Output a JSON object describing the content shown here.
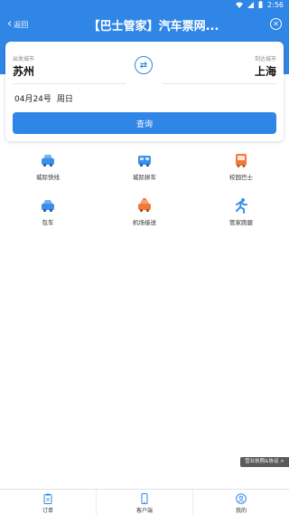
{
  "status": {
    "time": "2:56"
  },
  "header": {
    "back_label": "返回",
    "title": "【巴士管家】汽车票网..."
  },
  "search": {
    "from_label": "出发城市",
    "from_city": "苏州",
    "to_label": "到达城市",
    "to_city": "上海",
    "date": "04月24号",
    "weekday": "周日",
    "button_label": "查询"
  },
  "services": [
    {
      "label": "城际快线",
      "icon": "car-icon",
      "color": "#3b8fe6"
    },
    {
      "label": "城际拼车",
      "icon": "van-icon",
      "color": "#3b8fe6"
    },
    {
      "label": "校园巴士",
      "icon": "bus-icon",
      "color": "#f07a3a"
    },
    {
      "label": "包车",
      "icon": "car-icon",
      "color": "#3b8fe6"
    },
    {
      "label": "机场接送",
      "icon": "taxi-icon",
      "color": "#f07a3a"
    },
    {
      "label": "管家跑腿",
      "icon": "runner-icon",
      "color": "#3b8fe6"
    }
  ],
  "license_label": "营业执照&协议 >",
  "tabs": [
    {
      "label": "订单",
      "icon": "clipboard-icon"
    },
    {
      "label": "客户端",
      "icon": "phone-icon"
    },
    {
      "label": "我的",
      "icon": "user-icon"
    }
  ],
  "colors": {
    "primary": "#2f86e6",
    "accent": "#f07a3a"
  }
}
